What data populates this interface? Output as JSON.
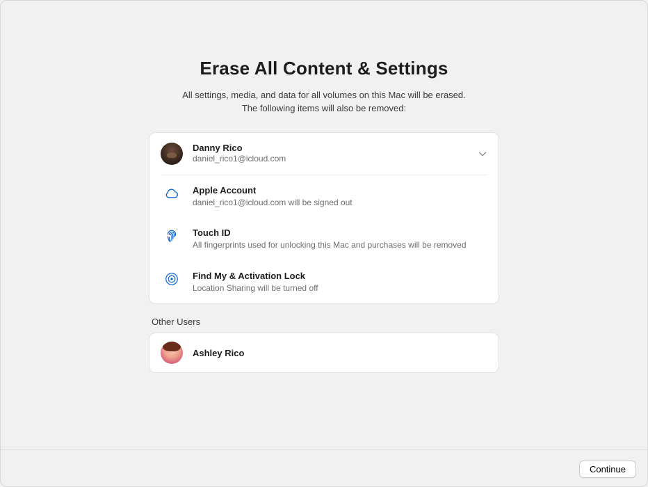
{
  "title": "Erase All Content & Settings",
  "subtitle_line1": "All settings, media, and data for all volumes on this Mac will be erased.",
  "subtitle_line2": "The following items will also be removed:",
  "primary_user": {
    "name": "Danny Rico",
    "email": "daniel_rico1@icloud.com"
  },
  "items": [
    {
      "icon": "cloud",
      "title": "Apple Account",
      "desc": "daniel_rico1@icloud.com will be signed out"
    },
    {
      "icon": "fingerprint",
      "title": "Touch ID",
      "desc": "All fingerprints used for unlocking this Mac and purchases will be removed"
    },
    {
      "icon": "findmy",
      "title": "Find My & Activation Lock",
      "desc": "Location Sharing will be turned off"
    }
  ],
  "other_users_label": "Other Users",
  "other_users": [
    {
      "name": "Ashley Rico"
    }
  ],
  "buttons": {
    "continue": "Continue"
  }
}
